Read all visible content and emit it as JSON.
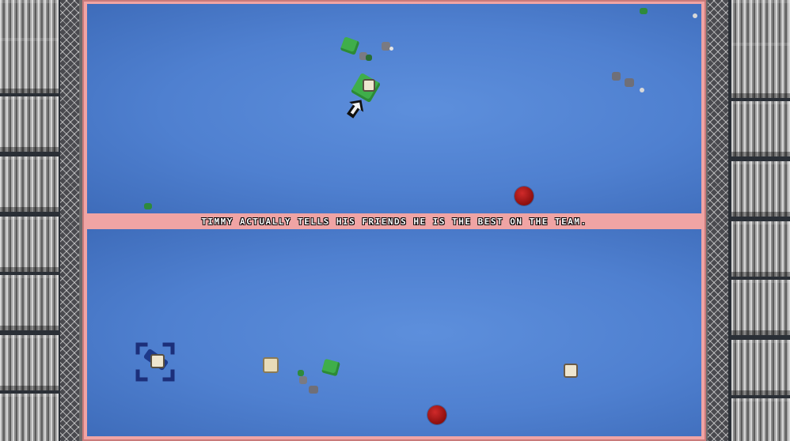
{
  "caption": {
    "text": "Timmy actually tells his friends he is the best on the team."
  },
  "colors": {
    "field_blue": "#4f80d0",
    "arena_border": "#f0a4a4",
    "ball_red": "#a81818",
    "bush_green": "#3fae4a",
    "rock_gray": "#7a7a82"
  }
}
